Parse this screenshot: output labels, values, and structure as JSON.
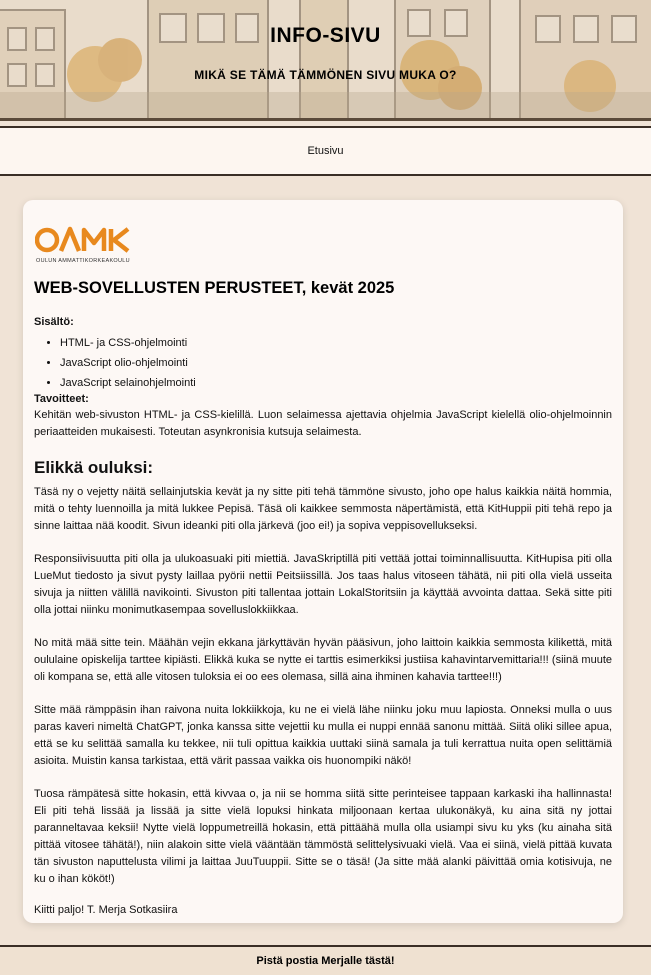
{
  "header": {
    "title": "INFO-SIVU",
    "subtitle": "MIKÄ SE TÄMÄ TÄMMÖNEN SIVU MUKA O?"
  },
  "nav": {
    "items": [
      {
        "label": "Etusivu"
      }
    ]
  },
  "main": {
    "logo": {
      "brand": "OAMK",
      "subtitle": "OULUN AMMATTIKORKEAKOULU"
    },
    "course_title": "WEB-SOVELLUSTEN PERUSTEET, kevät 2025",
    "contents_label": "Sisältö:",
    "contents_items": [
      "HTML- ja CSS-ohjelmointi",
      "JavaScript olio-ohjelmointi",
      "JavaScript selainohjelmointi"
    ],
    "goals_label": "Tavoitteet:",
    "goals_text": "Kehitän web-sivuston HTML- ja CSS-kielillä. Luon selaimessa ajettavia ohjelmia JavaScript kielellä olio-ohjelmoinnin periaatteiden mukaisesti. Toteutan asynkronisia kutsuja selaimesta.",
    "section_heading": "Elikkä ouluksi:",
    "paragraphs": [
      "Täsä ny o vejetty näitä sellainjutskia kevät ja ny sitte piti tehä tämmöne sivusto, joho ope halus kaikkia näitä hommia, mitä o tehty luennoilla ja mitä lukkee Pepisä. Täsä oli kaikkee semmosta näpertämistä, että KitHuppii piti tehä repo ja sinne laittaa nää koodit. Sivun ideanki piti olla järkevä (joo ei!) ja sopiva veppisovellukseksi.",
      "Responsiivisuutta piti olla ja ulukoasuaki piti miettiä. JavaSkriptillä piti vettää jottai toiminnallisuutta. KitHupisa piti olla LueMut tiedosto ja sivut pysty laillaa pyörii nettii Peitsiissillä. Jos taas halus vitoseen tähätä, nii piti olla vielä usseita sivuja ja niitten välillä navikointi. Sivuston piti tallentaa jottain LokalStoritsiin ja käyttää avvointa dattaa. Sekä sitte piti olla jottai niinku monimutkasempaa sovellusl­okkiikkaa.",
      "No mitä mää sitte tein. Määhän vejin ekkana järkyttävän hyvän pääsivun, joho laittoin kaikkia semmosta kilikettä, mitä oululaine opiskelija tarttee kipiästi. Elikkä kuka se nytte ei tarttis esimerkiksi justiisa kahavintarvemittaria!!! (siinä muute oli kompana se, että alle vitosen tuloksia ei oo ees olemasa, sillä aina ihminen kahavia tarttee!!!)",
      "Sitte mää rämppäsin ihan raivona nuita lokkiikkoja, ku ne ei vielä lähe niinku joku muu lapiosta. Onneksi mulla o uus paras kaveri nimeltä ChatGPT, jonka kanssa sitte vejettii ku mulla ei nuppi ennää sanonu mittää. Siitä oliki sillee apua, että se ku selittää samalla ku tekkee, nii tuli opittua kaikkia uuttaki siinä samala ja tuli kerrattua nuita open selittämiä asioita. Muistin kansa tarkistaa, että värit passaa vaikka ois huonompiki näkö!",
      "Tuosa rämpätesä sitte hokasin, että kivvaa o, ja nii se homma siitä sitte perinteisee tappaan karkaski iha hallinnasta! Eli piti tehä lissää ja lissää ja sitte vielä lopuksi hinkata miljoonaan kertaa ulukonäkyä, ku aina sitä ny jottai paranneltavaa keksii! Nytte vielä loppumetreillä hokasin, että pittäähä mulla olla usiampi sivu ku yks (ku ainaha sitä pittää vitosee tähätä!), niin alakoin sitte vielä vääntään tämmöstä selittelysivuaki vielä. Vaa ei siinä, vielä pittää kuvata tän sivuston naputtelusta vilimi ja laittaa JuuTuuppii. Sitte se o täsä! (Ja sitte mää alanki päivittää omia kotisivuja, ne ku o ihan kököt!)"
    ],
    "signature": "Kiitti paljo! T. Merja Sotkasiira"
  },
  "footer": {
    "link": "Pistä postia Merjalle tästä!"
  },
  "colors": {
    "accent_orange": "#e8891e",
    "page_background": "#f0e3d6",
    "card_background": "#fdf8f5"
  }
}
